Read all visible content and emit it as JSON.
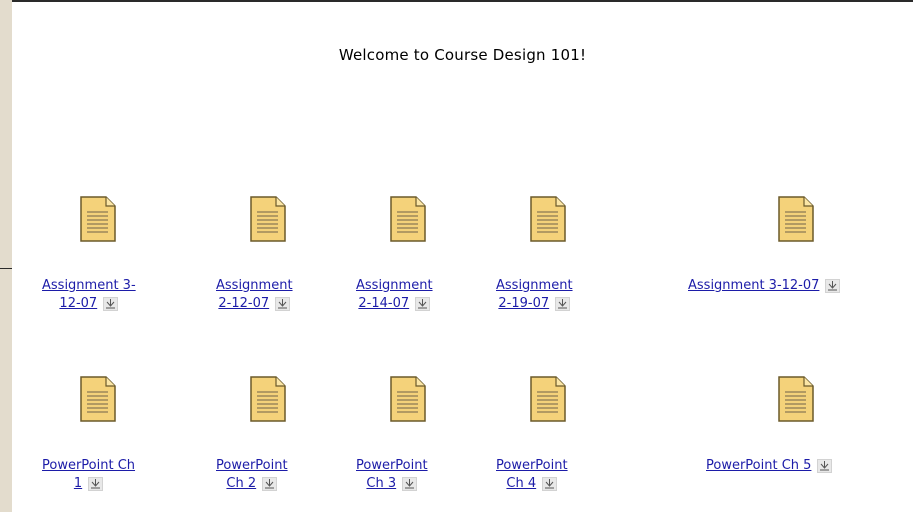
{
  "page": {
    "welcome": "Welcome to Course Design 101!"
  },
  "assignments": [
    {
      "line1": "Assignment 3-",
      "line2": "12-07"
    },
    {
      "line1": "Assignment",
      "line2": "2-12-07"
    },
    {
      "line1": "Assignment",
      "line2": "2-14-07"
    },
    {
      "line1": "Assignment",
      "line2": "2-19-07"
    },
    {
      "line1": "Assignment 3-12-07",
      "line2": ""
    }
  ],
  "powerpoints": [
    {
      "line1": "PowerPoint Ch",
      "line2": "1"
    },
    {
      "line1": "PowerPoint",
      "line2": "Ch 2"
    },
    {
      "line1": "PowerPoint",
      "line2": "Ch 3"
    },
    {
      "line1": "PowerPoint",
      "line2": "Ch 4"
    },
    {
      "line1": "PowerPoint Ch 5",
      "line2": ""
    }
  ],
  "icons": {
    "file": "document-icon",
    "download": "download-icon"
  },
  "colors": {
    "link": "#1c1ca8",
    "background": "#e3dccd",
    "panel": "#ffffff",
    "doc_fill": "#f4d27a"
  }
}
